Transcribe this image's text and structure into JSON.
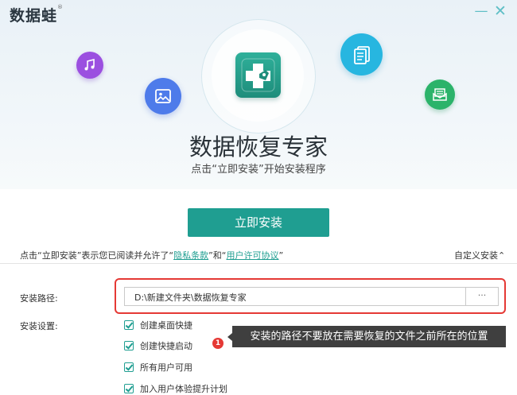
{
  "window": {
    "brand": "数据蛙",
    "brand_mark": "®",
    "minimize_icon": "—",
    "close_icon": "✕"
  },
  "hero": {
    "title": "数据恢复专家",
    "subtitle": "点击“立即安装”开始安装程序"
  },
  "icons": [
    "music-icon",
    "image-icon",
    "document-icon",
    "mail-icon",
    "app-logo-icon"
  ],
  "install_button": "立即安装",
  "agreement": {
    "prefix": "点击“立即安装”表示您已阅读并允许了“",
    "privacy": "隐私条款",
    "middle": "”和“",
    "license": "用户许可协议",
    "suffix": "”"
  },
  "custom_install": "自定义安装",
  "install_path": {
    "label": "安装路径:",
    "value": "D:\\新建文件夹\\数据恢复专家",
    "browse": "···"
  },
  "settings": {
    "label": "安装设置:",
    "options": [
      {
        "label": "创建桌面快捷",
        "checked": true
      },
      {
        "label": "创建快捷启动",
        "checked": true
      },
      {
        "label": "所有用户可用",
        "checked": true
      },
      {
        "label": "加入用户体验提升计划",
        "checked": true
      }
    ]
  },
  "annotation": {
    "number": "1",
    "text": "安装的路径不要放在需要恢复的文件之前所在的位置"
  },
  "colors": {
    "accent": "#1f9e91",
    "annotation": "#e53935"
  }
}
